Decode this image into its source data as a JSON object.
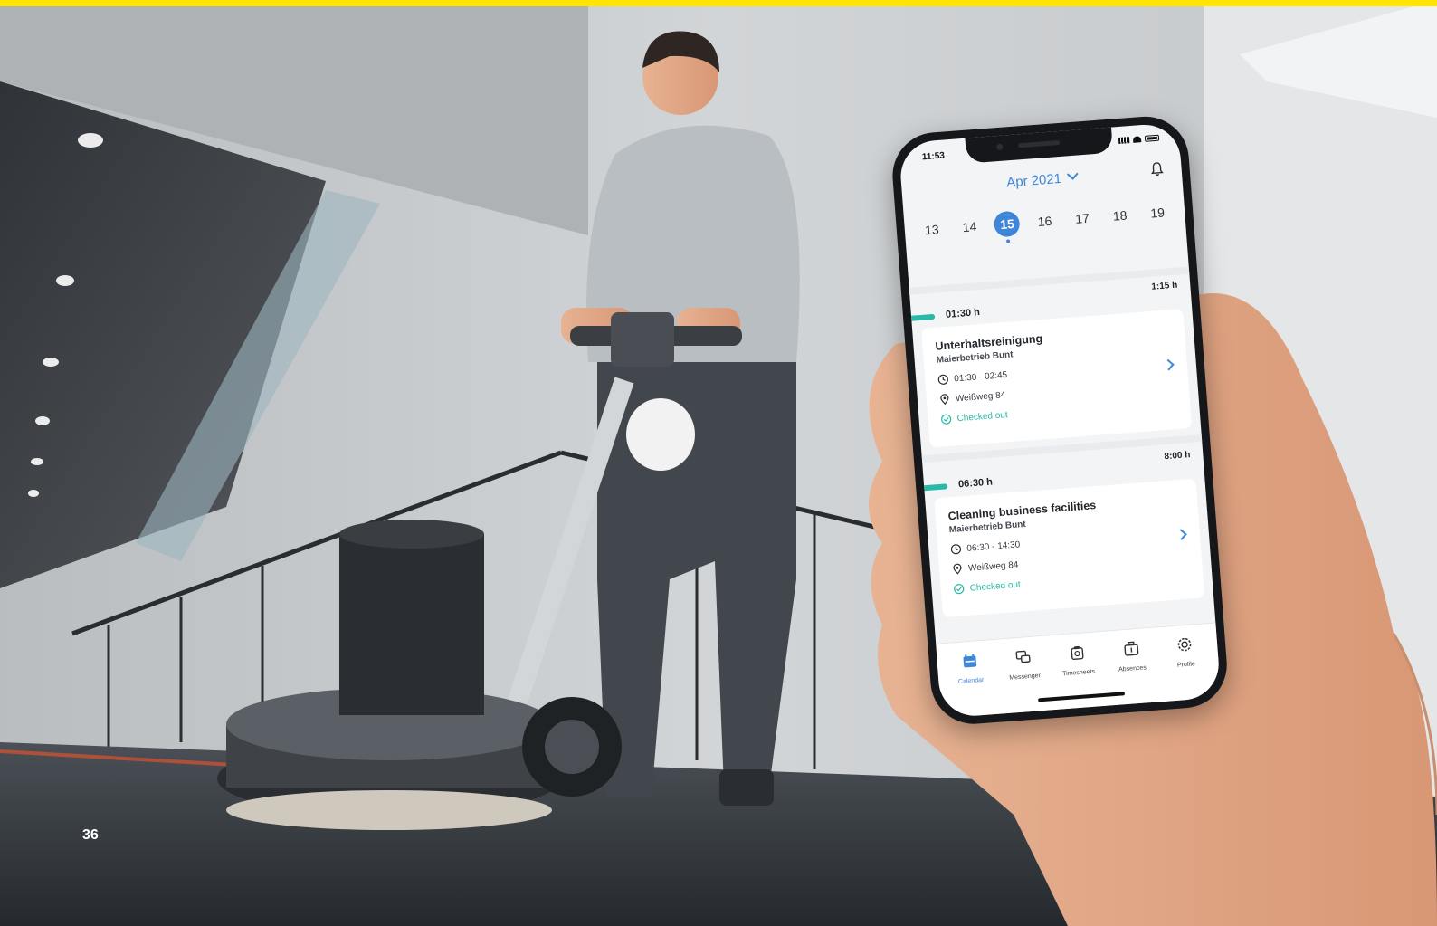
{
  "page": {
    "number": "36",
    "accent_color": "#ffe500"
  },
  "phone": {
    "status_bar": {
      "time": "11:53"
    },
    "calendar": {
      "month_label": "Apr 2021",
      "days": [
        {
          "num": "13",
          "selected": false
        },
        {
          "num": "14",
          "selected": false
        },
        {
          "num": "15",
          "selected": true
        },
        {
          "num": "16",
          "selected": false
        },
        {
          "num": "17",
          "selected": false
        },
        {
          "num": "18",
          "selected": false
        },
        {
          "num": "19",
          "selected": false
        }
      ]
    },
    "shifts": [
      {
        "start": "01:30 h",
        "duration": "1:15 h",
        "title": "Unterhaltsreinigung",
        "company": "Maierbetrieb Bunt",
        "time_range": "01:30 - 02:45",
        "address": "Weißweg 84",
        "status": "Checked out"
      },
      {
        "start": "06:30 h",
        "duration": "8:00 h",
        "title": "Cleaning business facilities",
        "company": "Maierbetrieb Bunt",
        "time_range": "06:30 - 14:30",
        "address": "Weißweg 84",
        "status": "Checked out"
      }
    ],
    "tabs": [
      {
        "label": "Calendar",
        "icon": "calendar-icon",
        "active": true
      },
      {
        "label": "Messenger",
        "icon": "messenger-icon",
        "active": false
      },
      {
        "label": "Timesheets",
        "icon": "timesheets-icon",
        "active": false
      },
      {
        "label": "Absences",
        "icon": "absences-icon",
        "active": false
      },
      {
        "label": "Profile",
        "icon": "gear-icon",
        "active": false
      }
    ],
    "colors": {
      "primary": "#3f86d9",
      "accent": "#2bb9a7"
    }
  }
}
